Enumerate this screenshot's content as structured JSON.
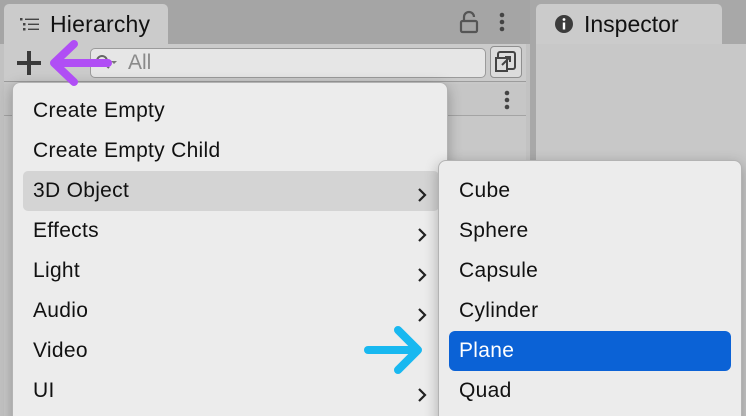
{
  "hierarchy": {
    "tab_label": "Hierarchy",
    "search_placeholder": "All"
  },
  "inspector": {
    "tab_label": "Inspector"
  },
  "create_menu": {
    "items": [
      {
        "label": "Create Empty"
      },
      {
        "label": "Create Empty Child"
      },
      {
        "label": "3D Object"
      },
      {
        "label": "Effects"
      },
      {
        "label": "Light"
      },
      {
        "label": "Audio"
      },
      {
        "label": "Video"
      },
      {
        "label": "UI"
      }
    ]
  },
  "submenu_3d": {
    "items": [
      {
        "label": "Cube"
      },
      {
        "label": "Sphere"
      },
      {
        "label": "Capsule"
      },
      {
        "label": "Cylinder"
      },
      {
        "label": "Plane"
      },
      {
        "label": "Quad"
      }
    ]
  },
  "colors": {
    "selection_blue": "#0b62d6",
    "annotation_purple": "#b04ef5",
    "annotation_cyan": "#18b8f0"
  },
  "icons": [
    "list-icon",
    "lock-icon",
    "kebab-icon",
    "plus-icon",
    "search-icon",
    "scene-view-icon",
    "info-icon",
    "chevron-right-icon",
    "arrow-icon"
  ]
}
